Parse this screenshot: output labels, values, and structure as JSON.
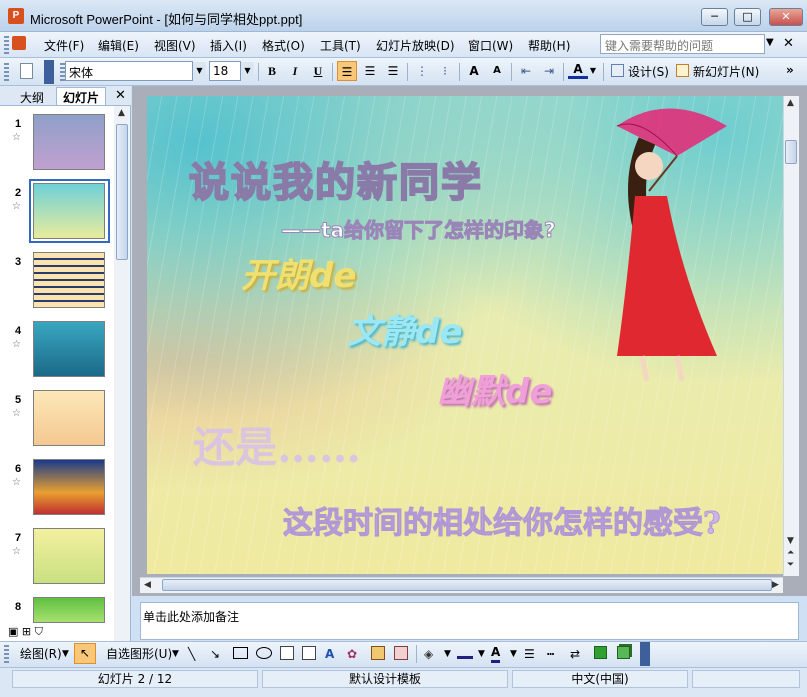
{
  "window": {
    "app_icon": "P",
    "title": "Microsoft PowerPoint - [如何与同学相处ppt.ppt]",
    "min": "─",
    "max": "□",
    "close": "✕"
  },
  "menu": {
    "items": [
      "文件(F)",
      "编辑(E)",
      "视图(V)",
      "插入(I)",
      "格式(O)",
      "工具(T)",
      "幻灯片放映(D)",
      "窗口(W)",
      "帮助(H)"
    ],
    "help_placeholder": "键入需要帮助的问题",
    "help_drop": "▼",
    "doc_close": "✕"
  },
  "format_toolbar": {
    "font": "宋体",
    "size": "18",
    "bold": "B",
    "italic": "I",
    "underline": "U",
    "design": "设计(S)",
    "new_slide": "新幻灯片(N)",
    "overflow": "»"
  },
  "pane": {
    "tab_outline": "大纲",
    "tab_slides": "幻灯片",
    "close": "✕",
    "slides": [
      {
        "num": "1",
        "star": "☆"
      },
      {
        "num": "2",
        "star": "☆"
      },
      {
        "num": "3",
        "star": ""
      },
      {
        "num": "4",
        "star": "☆"
      },
      {
        "num": "5",
        "star": "☆"
      },
      {
        "num": "6",
        "star": "☆"
      },
      {
        "num": "7",
        "star": "☆"
      },
      {
        "num": "8",
        "star": ""
      }
    ]
  },
  "slide": {
    "title": "说说我的新同学",
    "subtitle": "——ta给你留下了怎样的印象?",
    "word1": "开朗de",
    "word2": "文静de",
    "word3": "幽默de",
    "still": "还是……",
    "question": "这段时间的相处给你怎样的感受?"
  },
  "notes": {
    "placeholder": "单击此处添加备注"
  },
  "draw_toolbar": {
    "draw": "绘图(R)",
    "autoshapes": "自选图形(U)"
  },
  "status": {
    "slide": "幻灯片 2 / 12",
    "template": "默认设计模板",
    "language": "中文(中国)"
  },
  "colors": {
    "accent": "#cfe0f4",
    "selected_thumb": "#316ac5"
  }
}
